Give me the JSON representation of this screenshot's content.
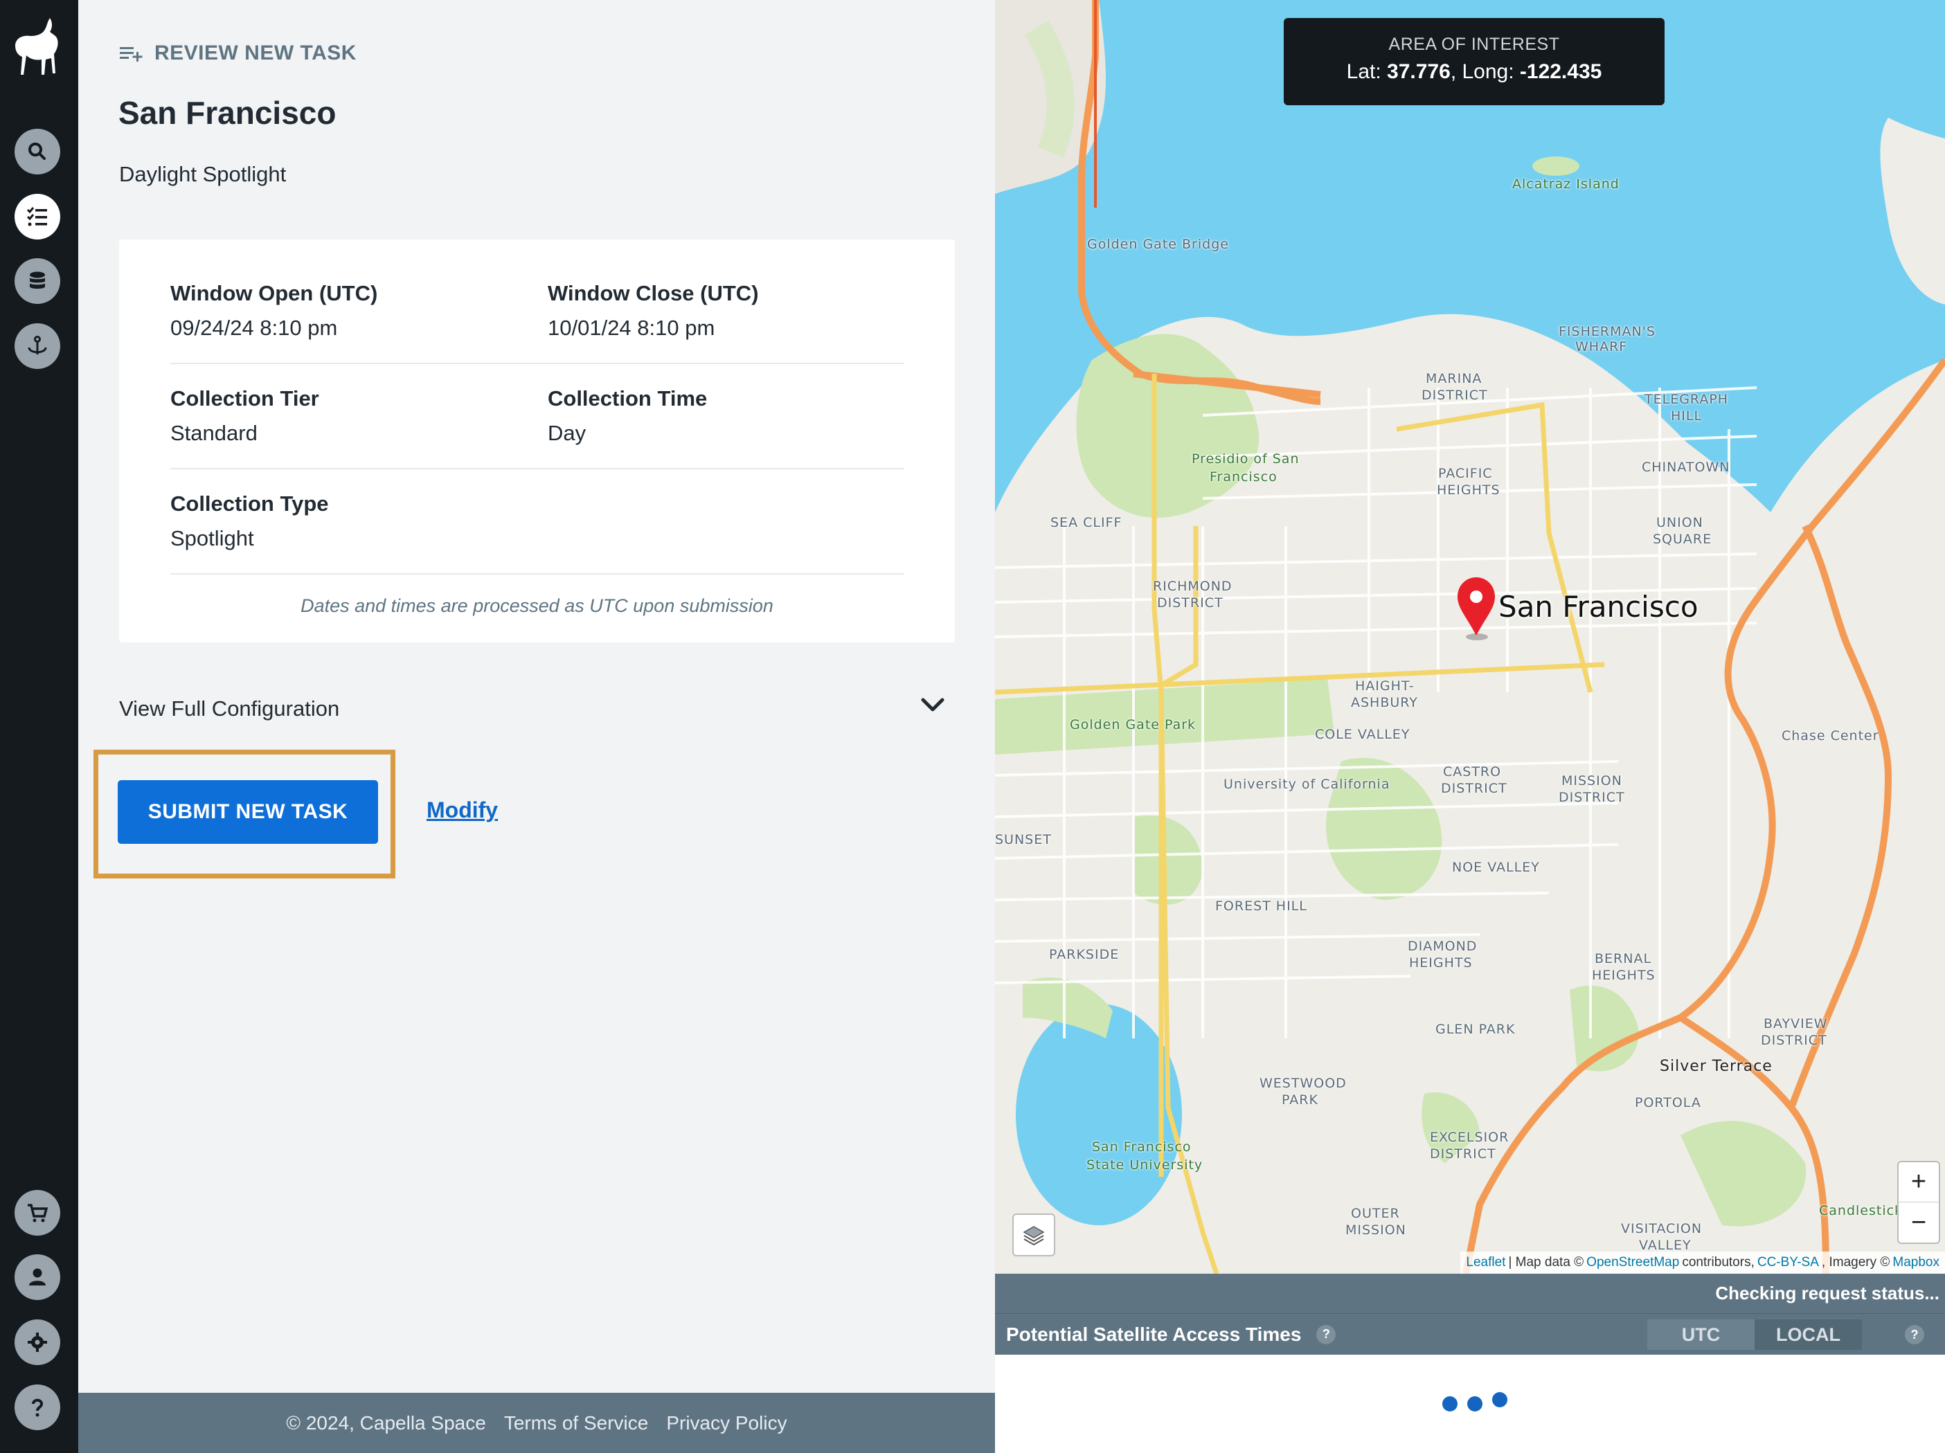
{
  "sidebar": {
    "nav": [
      {
        "id": "search",
        "icon": "search-icon"
      },
      {
        "id": "tasks",
        "icon": "tasks-list-icon",
        "active": true
      },
      {
        "id": "data",
        "icon": "database-icon"
      },
      {
        "id": "tasking",
        "icon": "anchor-icon"
      },
      {
        "id": "cart",
        "icon": "cart-icon"
      },
      {
        "id": "account",
        "icon": "user-icon"
      },
      {
        "id": "settings",
        "icon": "gear-icon"
      },
      {
        "id": "help",
        "icon": "help-icon"
      }
    ]
  },
  "header": {
    "section": "REVIEW NEW TASK",
    "title": "San Francisco",
    "subtitle": "Daylight Spotlight"
  },
  "details": {
    "window_open_label": "Window Open (UTC)",
    "window_open_value": "09/24/24 8:10 pm",
    "window_close_label": "Window Close (UTC)",
    "window_close_value": "10/01/24 8:10 pm",
    "tier_label": "Collection Tier",
    "tier_value": "Standard",
    "time_label": "Collection Time",
    "time_value": "Day",
    "type_label": "Collection Type",
    "type_value": "Spotlight",
    "note": "Dates and times are processed as UTC upon submission"
  },
  "config": {
    "label": "View Full Configuration"
  },
  "actions": {
    "submit_label": "SUBMIT NEW TASK",
    "modify_label": "Modify"
  },
  "footer": {
    "copyright": "© 2024, Capella Space",
    "terms": "Terms of Service",
    "privacy": "Privacy Policy"
  },
  "map": {
    "aoi_title": "AREA OF INTEREST",
    "lat_label": "Lat: ",
    "lat_value": "37.776",
    "long_label": ", Long: ",
    "long_value": "-122.435",
    "pin_label": "San Francisco",
    "zoom_in": "+",
    "zoom_out": "−",
    "labels": {
      "alcatraz": "Alcatraz Island",
      "ggb": "Golden Gate Bridge",
      "fishermans": "FISHERMAN'S",
      "wharf": "WHARF",
      "marina": "MARINA",
      "district": "DISTRICT",
      "presidio": "Presidio of San",
      "francisco": "Francisco",
      "pacific": "PACIFIC",
      "heights": "HEIGHTS",
      "telegraph": "TELEGRAPH",
      "hill": "HILL",
      "chinatown": "CHINATOWN",
      "union": "UNION",
      "square": "SQUARE",
      "richmond": "RICHMOND",
      "ggpark": "Golden Gate Park",
      "haight": "HAIGHT-",
      "ashbury": "ASHBURY",
      "cole": "COLE VALLEY",
      "ucsf": "University of California",
      "castro": "CASTRO",
      "mission": "MISSION",
      "noe": "NOE VALLEY",
      "sunset": "SUNSET",
      "parkside": "PARKSIDE",
      "forest": "FOREST HILL",
      "diamond": "DIAMOND",
      "bernal": "BERNAL",
      "glen": "GLEN PARK",
      "westwood": "WESTWOOD",
      "park": "PARK",
      "excelsior": "EXCELSIOR",
      "outer": "OUTER",
      "sfsu1": "San Francisco",
      "sfsu2": "State University",
      "portola": "PORTOLA",
      "silver": "Silver Terrace",
      "bayview": "BAYVIEW",
      "visitacion": "VISITACION",
      "valley": "VALLEY",
      "chase": "Chase Center",
      "candlestick": "Candlestick",
      "seacliff": "SEA CLIFF"
    },
    "attribution": {
      "leaflet": "Leaflet",
      "mapdata": "| Map data ©",
      "osm": "OpenStreetMap",
      "contrib": "contributors,",
      "ccbysa": "CC-BY-SA",
      "imagery": ", Imagery ©",
      "mapbox": "Mapbox"
    }
  },
  "access": {
    "status": "Checking request status...",
    "title": "Potential Satellite Access Times",
    "help": "?",
    "utc": "UTC",
    "local": "LOCAL"
  },
  "colors": {
    "sidebar": "#151a1f",
    "accent": "#0f6fd8",
    "highlight": "#d69b43",
    "water": "#75cff0",
    "park": "#cde6b4",
    "highway": "#f39b54",
    "marker": "#e8202a"
  }
}
